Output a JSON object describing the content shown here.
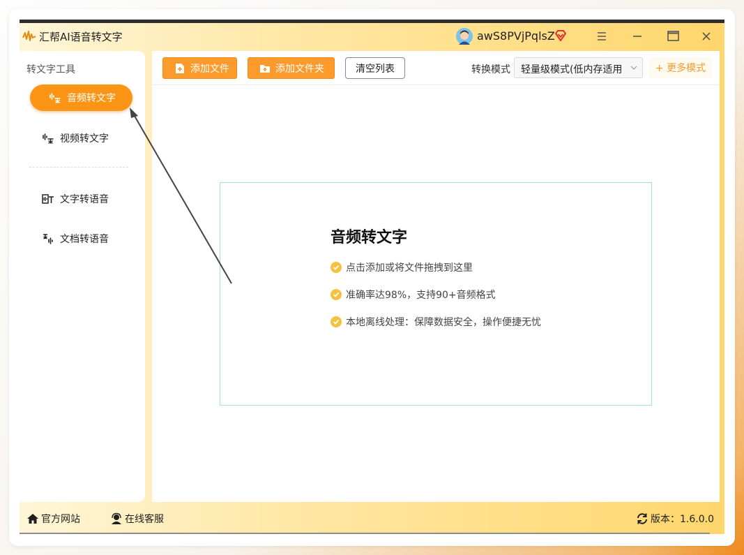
{
  "window": {
    "title": "汇帮AI语音转文字",
    "username": "awS8PVjPqlsZ"
  },
  "sidebar": {
    "section_title": "转文字工具",
    "items": [
      {
        "label": "音频转文字",
        "active": true
      },
      {
        "label": "视频转文字",
        "active": false
      },
      {
        "label": "文字转语音",
        "active": false
      },
      {
        "label": "文档转语音",
        "active": false
      }
    ]
  },
  "toolbar": {
    "add_file": "添加文件",
    "add_folder": "添加文件夹",
    "clear_list": "清空列表",
    "mode_label": "转换模式",
    "mode_value": "轻量级模式(低内存适用",
    "more_modes": "+ 更多模式"
  },
  "dropzone": {
    "title": "音频转文字",
    "lines": [
      "点击添加或将文件拖拽到这里",
      "准确率达98%，支持90+音频格式",
      "本地离线处理：保障数据安全，操作便捷无忧"
    ]
  },
  "footer": {
    "website": "官方网站",
    "support": "在线客服",
    "version": "版本：1.6.0.0"
  },
  "colors": {
    "accent": "#fc9515",
    "dropzone_border": "#a6e3c5",
    "check": "#f5c141"
  }
}
